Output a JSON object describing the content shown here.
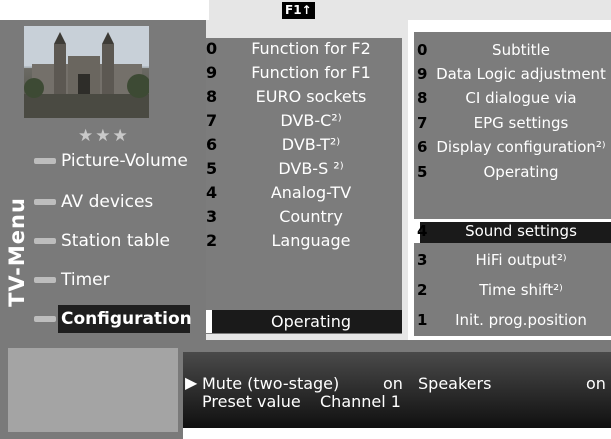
{
  "top": {
    "key_label": "F1↑"
  },
  "sidebar": {
    "rating_stars": "★★★",
    "title": "TV-Menu",
    "items": [
      {
        "label": "Picture-Volume"
      },
      {
        "label": "AV devices"
      },
      {
        "label": "Station table"
      },
      {
        "label": "Timer"
      },
      {
        "label": "Configuration",
        "selected": true
      }
    ]
  },
  "middle_menu": [
    {
      "num": "0",
      "label": "Function for F2"
    },
    {
      "num": "9",
      "label": "Function for F1"
    },
    {
      "num": "8",
      "label": "EURO sockets"
    },
    {
      "num": "7",
      "label": "DVB-C²⁾"
    },
    {
      "num": "6",
      "label": "DVB-T²⁾"
    },
    {
      "num": "5",
      "label": "DVB-S ²⁾"
    },
    {
      "num": "4",
      "label": "Analog-TV"
    },
    {
      "num": "3",
      "label": "Country"
    },
    {
      "num": "2",
      "label": "Language"
    },
    {
      "num": "",
      "label": "Operating",
      "selected": true
    }
  ],
  "right_menu": [
    {
      "num": "0",
      "label": "Subtitle"
    },
    {
      "num": "9",
      "label": "Data Logic adjustment"
    },
    {
      "num": "8",
      "label": "CI dialogue via"
    },
    {
      "num": "7",
      "label": "EPG settings"
    },
    {
      "num": "6",
      "label": "Display configuration²⁾"
    },
    {
      "num": "5",
      "label": "Operating"
    },
    {
      "num": "4",
      "label": "Sound settings",
      "selected": true
    },
    {
      "num": "3",
      "label": "HiFi output²⁾"
    },
    {
      "num": "2",
      "label": "Time shift²⁾"
    },
    {
      "num": "1",
      "label": "Init. prog.position"
    }
  ],
  "info": {
    "pointer": "▶",
    "line1_label": "Mute (two-stage)",
    "line1_value": "on",
    "line1_label2": "Speakers",
    "line1_value2": "on",
    "line2_label": "Preset value",
    "line2_value": "Channel 1"
  }
}
